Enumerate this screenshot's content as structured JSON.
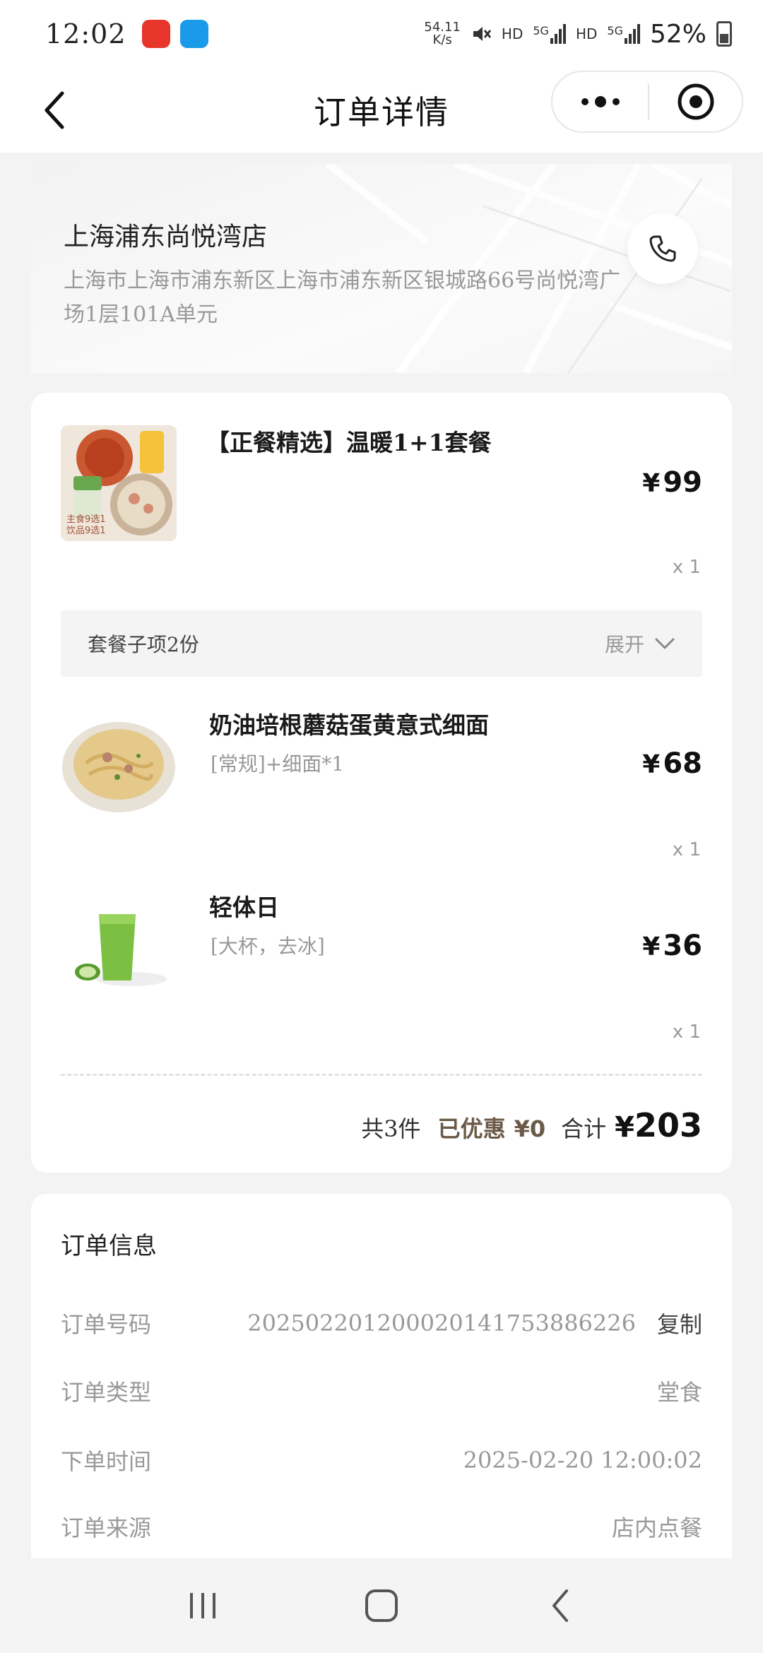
{
  "status_bar": {
    "time": "12:02",
    "net_speed_value": "54.11",
    "net_speed_unit": "K/s",
    "hd_1": "HD",
    "signal_1": "5G",
    "hd_2": "HD",
    "signal_2": "5G",
    "battery": "52%"
  },
  "header": {
    "title": "订单详情"
  },
  "store": {
    "name": "上海浦东尚悦湾店",
    "address": "上海市上海市浦东新区上海市浦东新区银城路66号尚悦湾广场1层101A单元"
  },
  "order": {
    "main_item": {
      "name": "【正餐精选】温暖1+1套餐",
      "price": "99",
      "qty": "x 1",
      "thumb_caption_1": "主食9选1",
      "thumb_caption_2": "饮品9选1"
    },
    "combo_bar": {
      "label": "套餐子项2份",
      "expand": "展开"
    },
    "sub_items": [
      {
        "name": "奶油培根蘑菇蛋黄意式细面",
        "spec": "[常规]+细面*1",
        "price": "68",
        "qty": "x 1"
      },
      {
        "name": "轻体日",
        "spec": "[大杯，去冰]",
        "price": "36",
        "qty": "x 1"
      }
    ],
    "currency": "¥",
    "summary": {
      "count": "共3件",
      "discount_label": "已优惠",
      "discount_value": "¥0",
      "total_label": "合计",
      "total_currency": "¥",
      "total_value": "203"
    }
  },
  "order_info": {
    "title": "订单信息",
    "rows": [
      {
        "label": "订单号码",
        "value": "2025022012000201417538862​26",
        "action": "复制"
      },
      {
        "label": "订单类型",
        "value": "堂食"
      },
      {
        "label": "下单时间",
        "value": "2025-02-20 12:00:02"
      },
      {
        "label": "订单来源",
        "value": "店内点餐"
      }
    ]
  },
  "colors": {
    "background": "#f3f3f3",
    "card": "#ffffff",
    "discount": "#6b5a48",
    "muted_text": "#999999"
  }
}
